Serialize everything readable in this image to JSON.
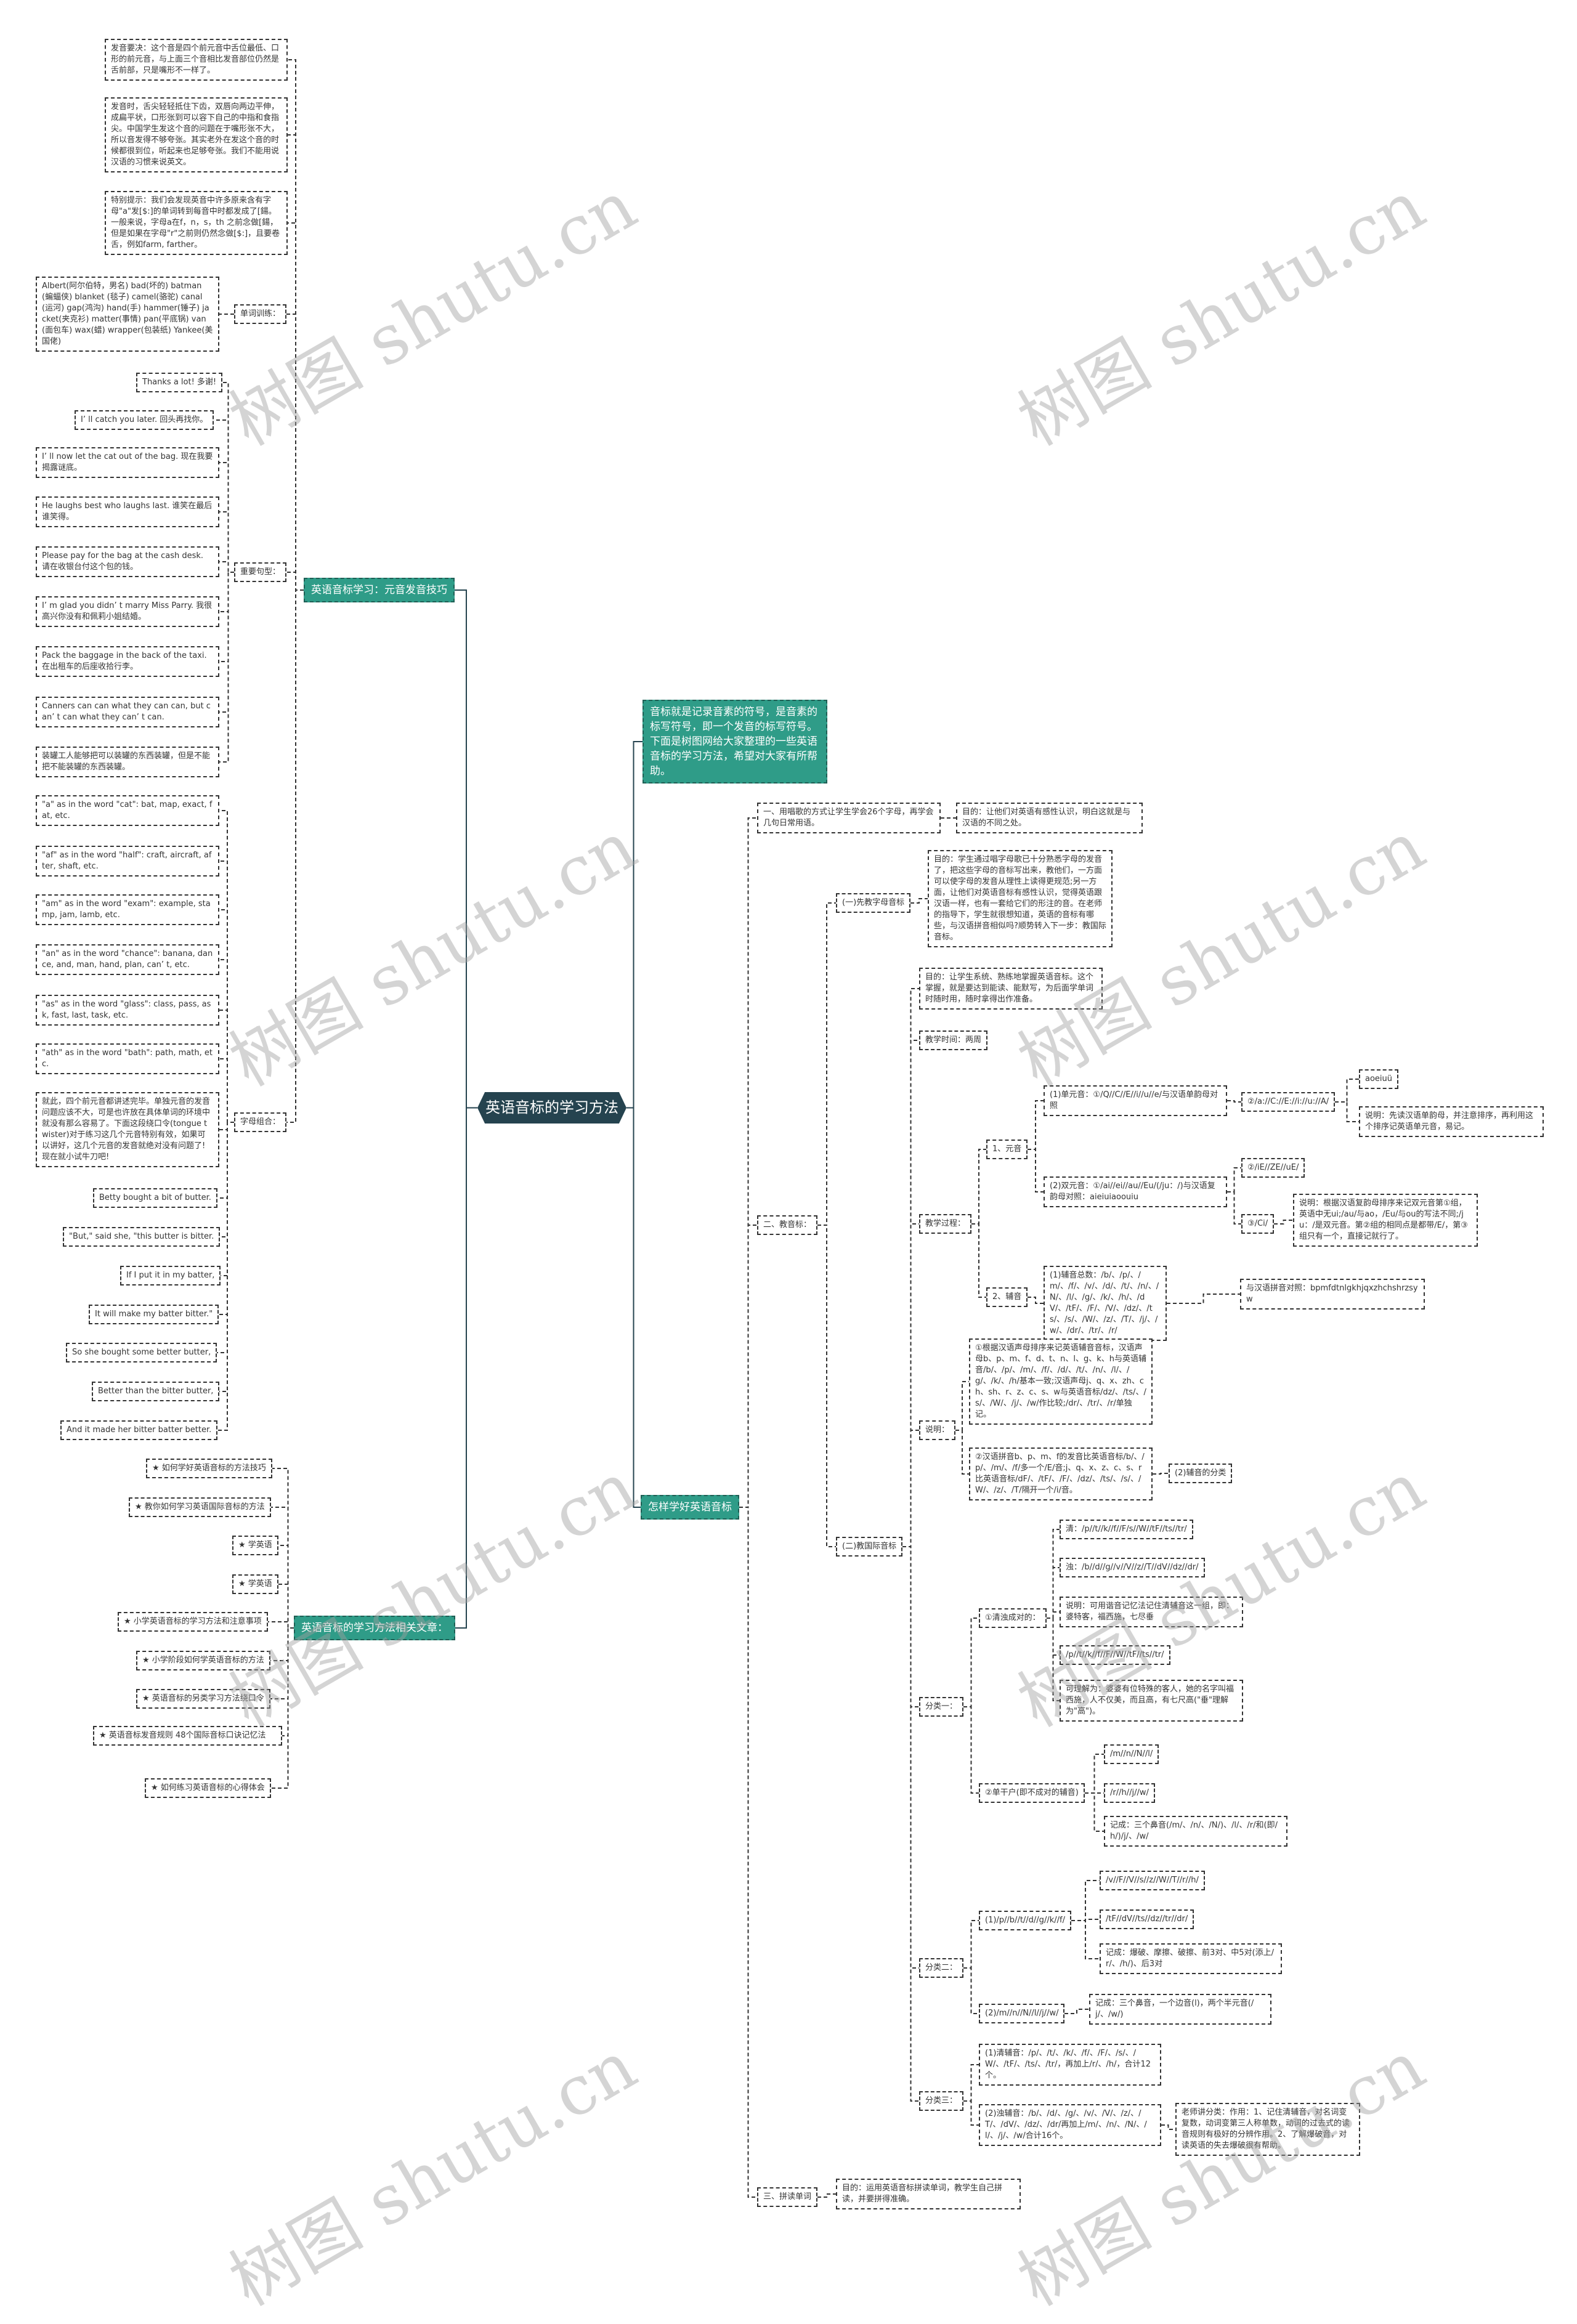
{
  "title": "英语音标的学习方法",
  "colors": {
    "center": "#25434f",
    "branch": "#2f9c88",
    "line": "#333333"
  },
  "watermark": "树图 shutu.cn",
  "left": {
    "vowel_branch": {
      "label": "英语音标学习：元音发音技巧",
      "notes": [
        "发音要决：这个音是四个前元音中舌位最低、口形的前元音，与上面三个音相比发音部位仍然是舌前部，只是嘴形不一样了。",
        "发音时，舌尖轻轻抵住下齿，双唇向两边平伸，成扁平状，口形张到可以容下自己的中指和食指尖。中国学生发这个音的问题在于嘴形张不大，所以音发得不够夸张。其实老外在发这个音的时候都很到位，听起来也足够夸张。我们不能用说汉语的习惯来说英文。",
        "特别提示：我们会发现英音中许多原来含有字母\"a\"发[$:]的单词转到每音中时都发成了[鍚。一般来说，字母a在f，n，s，th 之前念做[鍚，但是如果在字母\"r\"之前则仍然念做[$:]，且要卷舌，例如farm, farther。"
      ],
      "word_training": {
        "label": "单词训练：",
        "words": "Albert(阿尔伯特，男名) bad(坏的) batman (蝙蝠侠) blanket (毯子) camel(骆驼) canal(运河) gap(鸿沟) hand(手) hammer(锤子) jacket(夹克衫) matter(事情) pan(平底锅) van(面包车) wax(蜡) wrapper(包装纸) Yankee(美国佬)"
      },
      "sentences": {
        "label": "重要句型：",
        "items": [
          "Thanks a lot! 多谢!",
          "I’ ll catch you later. 回头再找你。",
          "I’ ll now let the cat out of the bag. 现在我要揭露谜底。",
          "He laughs best who laughs last. 谁笑在最后谁笑得。",
          "Please pay for the bag at the cash desk. 请在收银台付这个包的钱。",
          "I’ m glad you didn’ t marry Miss Parry. 我很高兴你没有和佩莉小姐结婚。",
          "Pack the baggage in the back of the taxi. 在出租车的后座收拾行李。",
          "Canners can can what they can can, but can’ t can what they can’ t can.",
          "装罐工人能够把可以装罐的东西装罐，但是不能把不能装罐的东西装罐。"
        ]
      },
      "letter_combos": {
        "label": "字母组合：",
        "items": [
          "\"a\" as in the word \"cat\": bat, map, exact, fat, etc.",
          "\"af\" as in the word \"half\": craft, aircraft, after, shaft, etc.",
          "\"am\" as in the word \"exam\": example, stamp, jam, lamb, etc.",
          "\"an\" as in the word \"chance\": banana, dance, and, man, hand, plan, can’ t, etc.",
          "\"as\" as in the word \"glass\": class, pass, ask, fast, last, task, etc.",
          "\"ath\" as in the word \"bath\": path, math, etc.",
          "就此，四个前元音都讲述完毕。单独元音的发音问题应该不大，可是也许放在具体单词的环境中就没有那么容易了。下面这段绕口令(tongue twister)对于练习这几个元音特别有效，如果可以讲好，这几个元音的发音就绝对没有问题了!现在就小试牛刀吧!"
        ],
        "tongue_twister": [
          "Betty bought a bit of butter.",
          "\"But,\" said she, \"this butter is bitter.",
          "If I put it in my batter,",
          "It will make my batter bitter.\"",
          "So she bought some better butter,",
          "Better than the bitter butter,",
          "And it made her bitter batter better."
        ]
      }
    },
    "articles": {
      "label": "英语音标的学习方法相关文章：",
      "items": [
        "★ 如何学好英语音标的方法技巧",
        "★ 教你如何学习英语国际音标的方法",
        "★ 学英语",
        "★ 学英语",
        "★ 小学英语音标的学习方法和注意事项",
        "★ 小学阶段如何学英语音标的方法",
        "★ 英语音标的另类学习方法绕口令",
        "★ 英语音标发音规则 48个国际音标口诀记忆法",
        "★ 如何练习英语音标的心得体会"
      ]
    }
  },
  "right": {
    "intro": "音标就是记录音素的符号，是音素的标写符号，即一个发音的标写符号。下面是树图网给大家整理的一些英语音标的学习方法，希望对大家有所帮助。",
    "how": {
      "label": "怎样学好英语音标",
      "step1": {
        "label": "一、用唱歌的方式让学生学会26个字母，再学会几句日常用语。",
        "purpose": "目的：让他们对英语有感性认识，明白这就是与汉语的不同之处。"
      },
      "step2": {
        "label": "二、教音标：",
        "part1": {
          "label": "(一)先教字母音标",
          "purpose": "目的：学生通过唱字母歌已十分熟悉字母的发音了，把这些字母的音标写出来，教他们，一方面可以使字母的发音从理性上读得更规范;另一方面，让他们对英语音标有感性认识，觉得英语跟汉语一样，也有一套给它们的形注的音。在老师的指导下，学生就很想知道，英语的音标有哪些，与汉语拼音相似吗?顺势转入下一步：教国际音标。"
        },
        "part2": {
          "label": "(二)教国际音标",
          "purpose": "目的：让学生系统、熟练地掌握英语音标。这个掌握，就是要达到能读、能默写，为后面学单词时随时用，随时拿得出作准备。",
          "time": "教学时间：两周",
          "process": {
            "label": "教学过程：",
            "vowels": {
              "label": "1、元音",
              "single": {
                "label": "(1)单元音：①/Q//C//E//i//u//e/与汉语单韵母对照",
                "sub": {
                  "label": "②/a://C://E://i://u://A/",
                  "items": [
                    "aoeiuü",
                    "说明：先读汉语单韵母，并注意排序，再利用这个排序记英语单元音，易记。"
                  ]
                }
              },
              "double": {
                "label": "(2)双元音：①/ai//ei//au//Eu/(/ju：/)与汉语复韵母对照：aieiuiaoouiu",
                "items": [
                  "②/iE//ZE//uE/",
                  "③/Ci/"
                ],
                "note": "说明：根据汉语复韵母排序来记双元音第①组，英语中无ui;/au/与ao，/Eu/与ou的写法不同;/ju：/是双元音。第②组的相同点是都带/E/，第③组只有一个，直接记就行了。"
              }
            },
            "consonants": {
              "label": "2、辅音",
              "total": "(1)辅音总数：/b/、/p/、/m/、/f/、/v/、/d/、/t/、/n/、/N/、/l/、/g/、/k/、/h/、/dV/、/tF/、/F/、/V/、/dz/、/ts/、/s/、/W/、/z/、/T/、/j/、/w/、/dr/、/tr/、/r/",
              "compare": "与汉语拼音对照：bpmfdtnlgkhjqxzhchshrzsyw"
            }
          },
          "notes": {
            "label": "说明：",
            "items": [
              "①根据汉语声母排序来记英语辅音音标，汉语声母b、p、m、f、d、t、n、l、g、k、h与英语辅音/b/、/p/、/m/、/f/、/d/、/t/、/n/、/l/、/g/、/k/、/h/基本一致;汉语声母j、q、x、zh、ch、sh、r、z、c、s、w与英语音标/dz/、/ts/、/s/、/W/、/j/、/w/作比较;/dr/、/tr/、/r/单独记。",
              "②汉语拼音b、p、m、f的发音比英语音标/b/、/p/、/m/、/f/多一个/E/音;j、q、x、z、c、s、r比英语音标/dF/、/tF/、/F/、/dz/、/ts/、/s/、/W/、/z/、/T/隔开一个/i/音。"
            ],
            "classification": "(2)辅音的分类"
          },
          "class1": {
            "label": "分类一：",
            "pairs": {
              "label": "①清浊成对的：",
              "items": [
                "清：/p//t//k//f//F/s//W//tF//ts//tr/",
                "浊：/b//d//g//v//V//z//T//dV//dz//dr/",
                "说明：可用谐音记忆法记住清辅音这一组，即：婆特客，福西施，七尽垂",
                "/p//t//k//f//F//W//tF//ts//tr/",
                "可理解为：婆婆有位特殊的客人，她的名字叫福西施，人不仅美，而且高，有七尺高(\"垂\"理解为\"高\")。"
              ]
            },
            "singles": {
              "label": "②单干户(即不成对的辅音)",
              "items": [
                "/m//n//N//l/",
                "/r//h//j//w/",
                "记成：三个鼻音(/m/、/n/、/N/)、/l/、/r/和(即/h/)/j/、/w/"
              ]
            }
          },
          "class2": {
            "label": "分类二：",
            "g1": {
              "label": "(1)/p//b//t//d//g//k//f/",
              "items": [
                "/v//F//V//s//z//W//T//r//h/",
                "/tF//dV//ts//dz//tr//dr/",
                "记成：爆破、摩擦、破擦、前3对、中5对(添上/r/、/h/)、后3对"
              ]
            },
            "g2": {
              "label": "(2)/m//n//N//l//j//w/",
              "note": "记成：三个鼻音，一个边音(l)，两个半元音(/j/、/w/)"
            }
          },
          "class3": {
            "label": "分类三：",
            "items": [
              "(1)清辅音：/p/、/t/、/k/、/f/、/F/、/s/、/W/、/tF/、/ts/、/tr/，再加上/r/、/h/，合计12个。",
              "(2)浊辅音：/b/、/d/、/g/、/v/、/V/、/z/、/T/、/dV/、/dz/、/dr/再加上/m/、/n/、/N/、/l/、/j/、/w/合计16个。"
            ],
            "teacher_note": "老师讲分类：作用：1、记住清辅音，对名词变复数，动词变第三人称单数，动词的过去式的读音规则有极好的分辨作用。2、了解爆破音，对读英语的失去爆破很有帮助。"
          }
        }
      },
      "step3": {
        "label": "三、拼读单词",
        "purpose": "目的：运用英语音标拼读单词，教学生自己拼读，并要拼得准确。"
      }
    }
  }
}
